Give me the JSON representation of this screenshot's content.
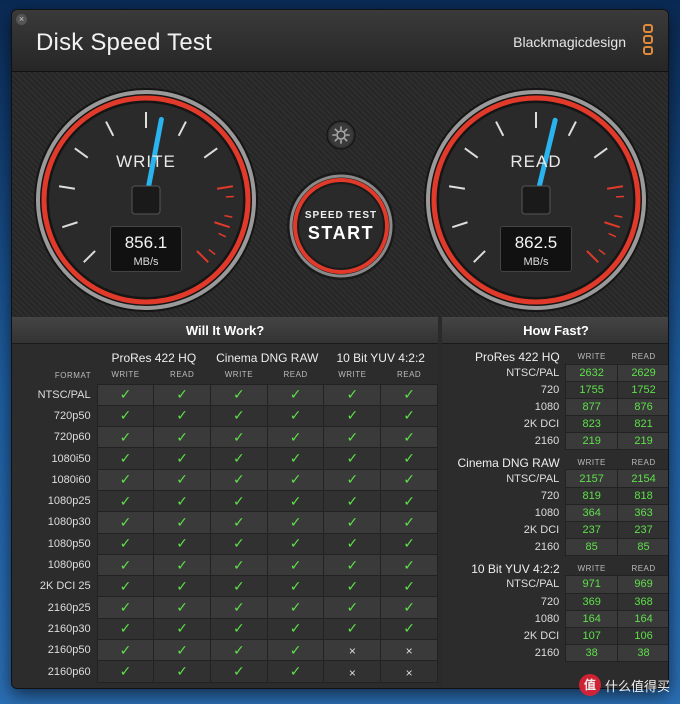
{
  "window": {
    "title": "Disk Speed Test",
    "brand": "Blackmagicdesign",
    "close_glyph": "×"
  },
  "gauges": {
    "write": {
      "label": "WRITE",
      "value": "856.1",
      "unit": "MB/s",
      "level": 0.54
    },
    "read": {
      "label": "READ",
      "value": "862.5",
      "unit": "MB/s",
      "level": 0.55
    }
  },
  "start": {
    "small": "SPEED TEST",
    "big": "START"
  },
  "colors": {
    "accent_red": "#e23a2a",
    "needle_blue": "#2ab4ef",
    "check_green": "#5ee04a",
    "logo_orange": "#e08a3a"
  },
  "icons": {
    "settings": "gear-icon",
    "close": "close-icon",
    "check": "check-icon",
    "cross": "cross-icon"
  },
  "will_it_work": {
    "title": "Will It Work?",
    "format_label": "FORMAT",
    "codecs": [
      "ProRes 422 HQ",
      "Cinema DNG RAW",
      "10 Bit YUV 4:2:2"
    ],
    "sub_headers": [
      "WRITE",
      "READ"
    ],
    "rows": [
      {
        "format": "NTSC/PAL",
        "marks": [
          1,
          1,
          1,
          1,
          1,
          1
        ]
      },
      {
        "format": "720p50",
        "marks": [
          1,
          1,
          1,
          1,
          1,
          1
        ]
      },
      {
        "format": "720p60",
        "marks": [
          1,
          1,
          1,
          1,
          1,
          1
        ]
      },
      {
        "format": "1080i50",
        "marks": [
          1,
          1,
          1,
          1,
          1,
          1
        ]
      },
      {
        "format": "1080i60",
        "marks": [
          1,
          1,
          1,
          1,
          1,
          1
        ]
      },
      {
        "format": "1080p25",
        "marks": [
          1,
          1,
          1,
          1,
          1,
          1
        ]
      },
      {
        "format": "1080p30",
        "marks": [
          1,
          1,
          1,
          1,
          1,
          1
        ]
      },
      {
        "format": "1080p50",
        "marks": [
          1,
          1,
          1,
          1,
          1,
          1
        ]
      },
      {
        "format": "1080p60",
        "marks": [
          1,
          1,
          1,
          1,
          1,
          1
        ]
      },
      {
        "format": "2K DCI 25",
        "marks": [
          1,
          1,
          1,
          1,
          1,
          1
        ]
      },
      {
        "format": "2160p25",
        "marks": [
          1,
          1,
          1,
          1,
          1,
          1
        ]
      },
      {
        "format": "2160p30",
        "marks": [
          1,
          1,
          1,
          1,
          1,
          1
        ]
      },
      {
        "format": "2160p50",
        "marks": [
          1,
          1,
          1,
          1,
          0,
          0
        ]
      },
      {
        "format": "2160p60",
        "marks": [
          1,
          1,
          1,
          1,
          0,
          0
        ]
      }
    ],
    "check_glyph": "✓",
    "cross_glyph": "×"
  },
  "how_fast": {
    "title": "How Fast?",
    "col_write": "WRITE",
    "col_read": "READ",
    "groups": [
      {
        "codec": "ProRes 422 HQ",
        "rows": [
          {
            "res": "NTSC/PAL",
            "write": "2632",
            "read": "2629"
          },
          {
            "res": "720",
            "write": "1755",
            "read": "1752"
          },
          {
            "res": "1080",
            "write": "877",
            "read": "876"
          },
          {
            "res": "2K DCI",
            "write": "823",
            "read": "821"
          },
          {
            "res": "2160",
            "write": "219",
            "read": "219"
          }
        ]
      },
      {
        "codec": "Cinema DNG RAW",
        "rows": [
          {
            "res": "NTSC/PAL",
            "write": "2157",
            "read": "2154"
          },
          {
            "res": "720",
            "write": "819",
            "read": "818"
          },
          {
            "res": "1080",
            "write": "364",
            "read": "363"
          },
          {
            "res": "2K DCI",
            "write": "237",
            "read": "237"
          },
          {
            "res": "2160",
            "write": "85",
            "read": "85"
          }
        ]
      },
      {
        "codec": "10 Bit YUV 4:2:2",
        "rows": [
          {
            "res": "NTSC/PAL",
            "write": "971",
            "read": "969"
          },
          {
            "res": "720",
            "write": "369",
            "read": "368"
          },
          {
            "res": "1080",
            "write": "164",
            "read": "164"
          },
          {
            "res": "2K DCI",
            "write": "107",
            "read": "106"
          },
          {
            "res": "2160",
            "write": "38",
            "read": "38"
          }
        ]
      }
    ]
  },
  "watermark": {
    "glyph": "值",
    "text": "什么值得买"
  }
}
